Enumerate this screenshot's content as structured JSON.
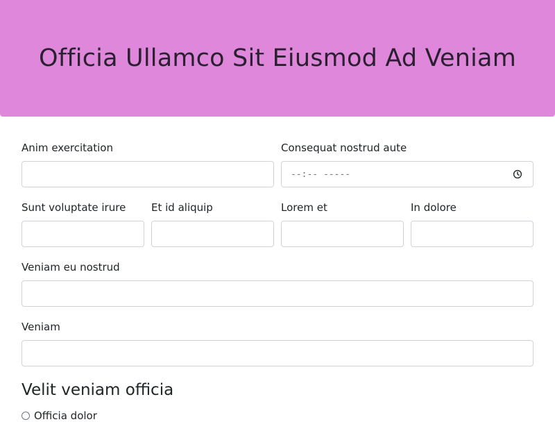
{
  "header": {
    "title": "Officia Ullamco Sit Eiusmod Ad Veniam",
    "background_color": "#df87db"
  },
  "form": {
    "fields": [
      {
        "label": "Anim exercitation",
        "value": ""
      },
      {
        "label": "Consequat nostrud aute",
        "type": "time",
        "placeholder": "--:-- -----",
        "icon": "clock-icon"
      },
      {
        "label": "Sunt voluptate irure",
        "value": ""
      },
      {
        "label": "Et id aliquip",
        "value": ""
      },
      {
        "label": "Lorem et",
        "value": ""
      },
      {
        "label": "In dolore",
        "value": ""
      },
      {
        "label": "Veniam eu nostrud",
        "value": ""
      },
      {
        "label": "Veniam",
        "value": ""
      }
    ],
    "section": {
      "title": "Velit veniam officia",
      "options": [
        {
          "label": "Officia dolor",
          "checked": false
        }
      ]
    }
  }
}
